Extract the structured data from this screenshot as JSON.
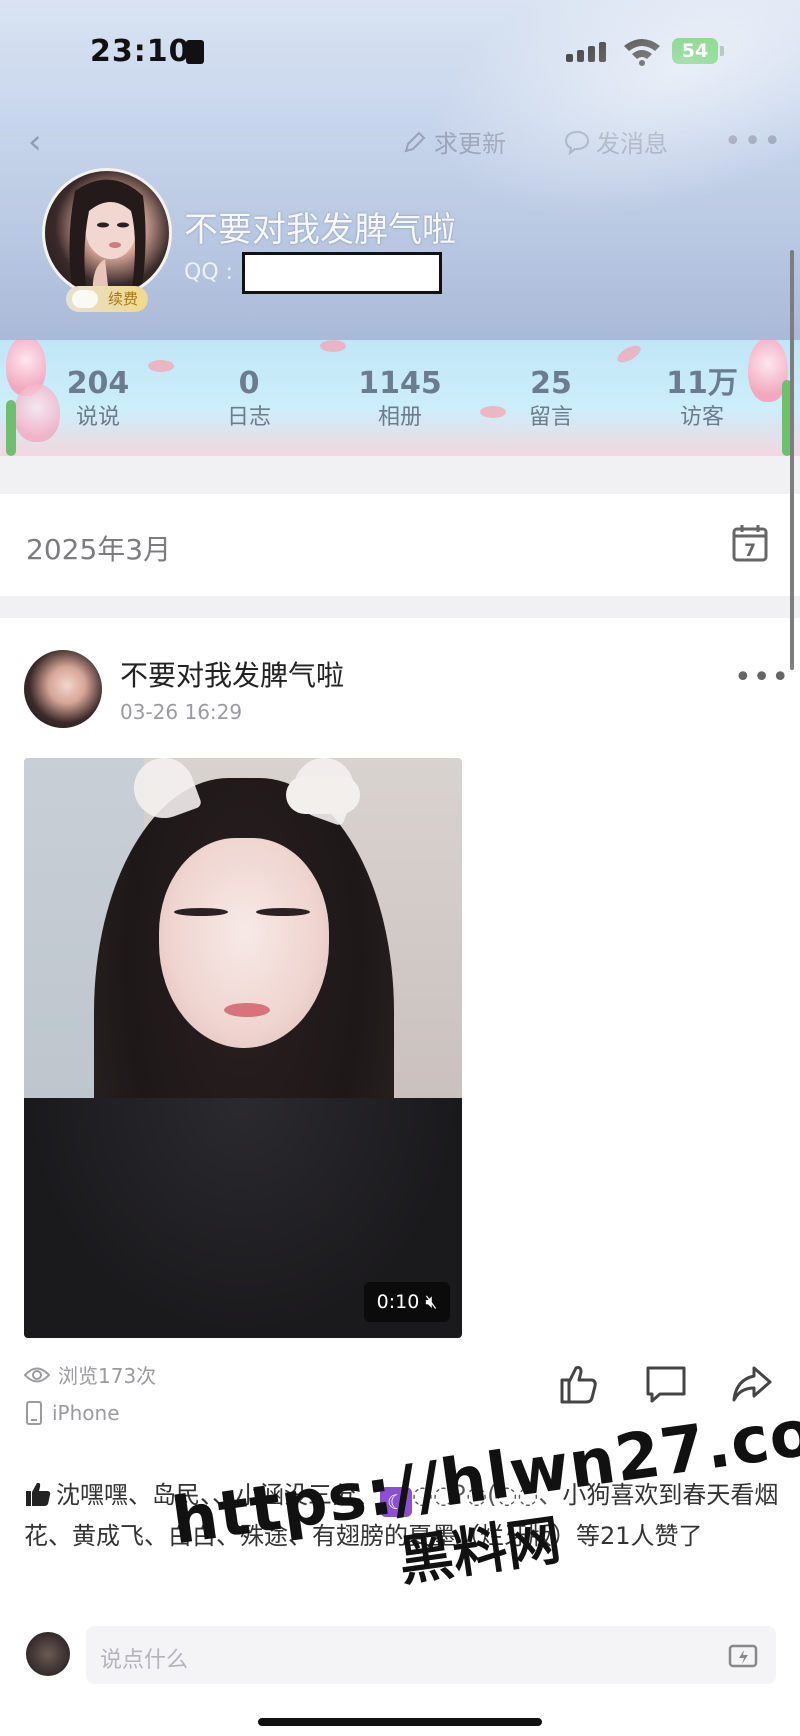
{
  "status_bar": {
    "time": "23:10",
    "battery": "54"
  },
  "nav": {
    "update_label": "求更新",
    "message_label": "发消息"
  },
  "profile": {
    "name": "不要对我发脾气啦",
    "qq_prefix": "QQ :",
    "vip_label": "续费"
  },
  "stats": [
    {
      "value": "204",
      "label": "说说"
    },
    {
      "value": "0",
      "label": "日志"
    },
    {
      "value": "1145",
      "label": "相册"
    },
    {
      "value": "25",
      "label": "留言"
    },
    {
      "value": "11万",
      "label": "访客"
    }
  ],
  "month": {
    "label": "2025年3月",
    "calendar_day": "7"
  },
  "post": {
    "author": "不要对我发脾气啦",
    "time": "03-26 16:29",
    "duration": "0:10",
    "views": "浏览173次",
    "device": "iPhone",
    "likes": {
      "names_part1": "沈嘿嘿、岛民、、小涵没三分、",
      "moon_glyph": "☾",
      "decor_text": "◌◌ʔ◌(◌◌、",
      "names_part2": "小狗喜欢到春天看烟花、黄成飞、白白、殊途、有翅膀的夏墨（烂牙版）等21人赞了"
    },
    "comment_placeholder": "说点什么"
  },
  "watermark": {
    "url": "https://hlwn27.com",
    "site": "黑料网"
  },
  "colors": {
    "stat_text": "#6b7c8f",
    "battery": "#3fbf4a",
    "accent_moon": "#8c4fd0"
  }
}
